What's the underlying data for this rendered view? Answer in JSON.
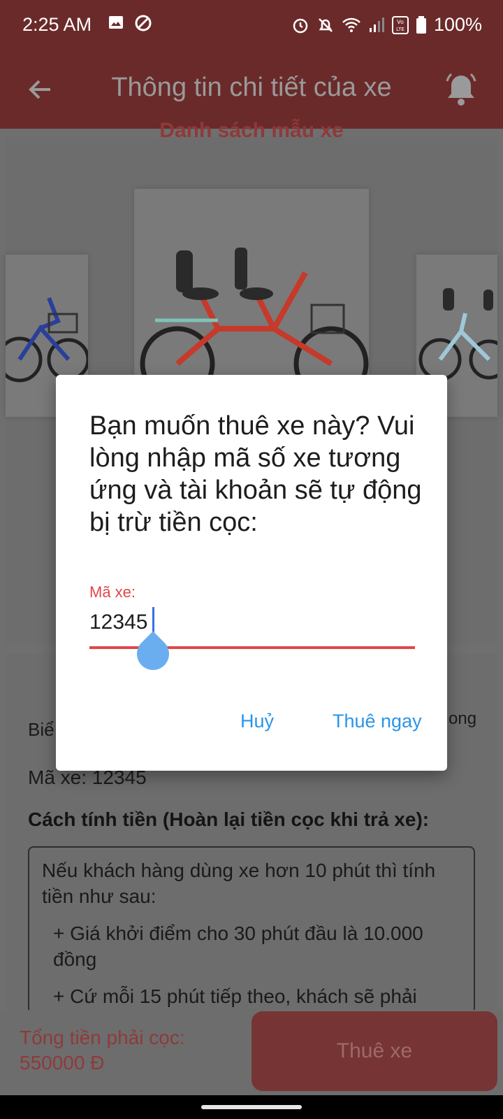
{
  "status_bar": {
    "time": "2:25 AM",
    "battery_text": "100%",
    "icons": [
      "image-icon",
      "do-not-disturb-icon",
      "alarm-icon",
      "bell-off-icon",
      "wifi-icon",
      "signal-icon",
      "volte-icon",
      "battery-icon"
    ]
  },
  "app_bar": {
    "title": "Thông tin chi tiết của xe",
    "back_icon": "arrow-left-icon",
    "bell_icon": "bell-icon"
  },
  "gallery": {
    "title": "Danh sách mẫu xe",
    "images": [
      "bicycle-blue",
      "tandem-bicycle-red",
      "tandem-bicycle-white"
    ]
  },
  "details": {
    "left_snippet": "Biể",
    "right_snippet": "ong",
    "bike_code_line": "Mã xe: 12345",
    "pricing_title": "Cách tính tiền (Hoàn lại tiền cọc khi trả xe):",
    "pricing_intro": "Nếu khách hàng dùng xe hơn 10 phút thì tính tiền như sau:",
    "pricing_items": [
      "+ Giá khởi điểm cho 30 phút đầu là 10.000 đồng",
      "+ Cứ mỗi 15 phút tiếp theo, khách sẽ phải"
    ]
  },
  "bottom_bar": {
    "deposit_label": "Tổng tiền phải cọc:",
    "deposit_value": "550000 Đ",
    "rent_button": "Thuê xe"
  },
  "dialog": {
    "message": "Bạn muốn thuê xe này? Vui lòng nhập mã số xe tương ứng và tài khoản sẽ tự động bị trừ tiền cọc:",
    "field_label": "Mã xe:",
    "field_value": "12345",
    "cancel_label": "Huỷ",
    "confirm_label": "Thuê ngay"
  },
  "colors": {
    "primary": "#b43a3a",
    "accent_link": "#2a95e8",
    "field_error": "#e04848",
    "handle": "#6aaef0"
  }
}
